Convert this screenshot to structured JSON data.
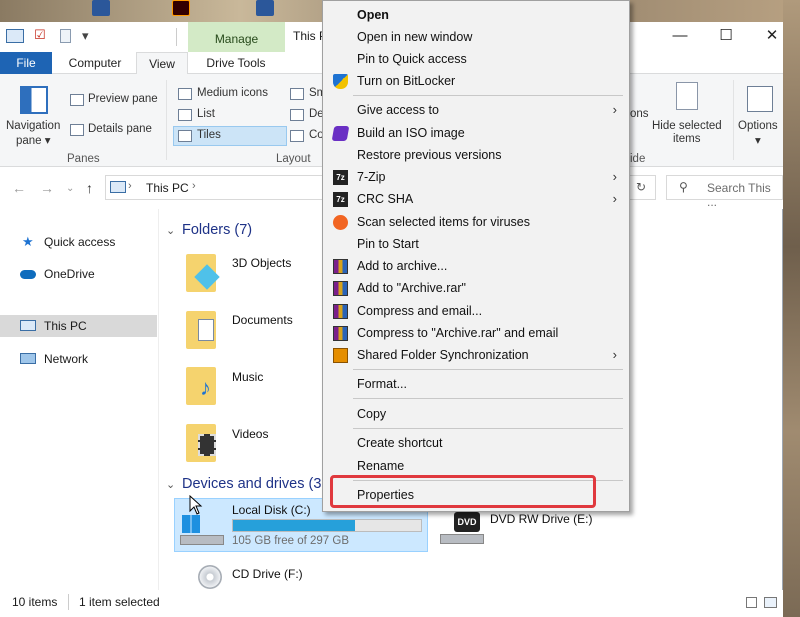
{
  "window": {
    "contextual_tab": "Manage",
    "title": "This PC",
    "minimize": "—",
    "maximize": "☐",
    "close": "✕"
  },
  "tabs": {
    "file": "File",
    "computer": "Computer",
    "view": "View",
    "drive_tools": "Drive Tools"
  },
  "ribbon": {
    "navigation_pane": "Navigation",
    "navigation_pane_2": "pane ▾",
    "preview_pane": "Preview pane",
    "details_pane": "Details pane",
    "panes_group": "Panes",
    "medium_icons": "Medium icons",
    "list": "List",
    "tiles": "Tiles",
    "small_partial": "Sm",
    "details_partial": "De",
    "content_partial": "Co",
    "layout_group": "Layout",
    "ons_partial": "ons",
    "hide_partial": "ide",
    "hide_selected": "Hide selected",
    "hide_selected_2": "items",
    "options": "Options",
    "options_caret": "▾"
  },
  "address": {
    "path": "This PC",
    "search_placeholder": "Search This ..."
  },
  "nav_pane": {
    "items": [
      "Quick access",
      "OneDrive",
      "This PC",
      "Network"
    ]
  },
  "content": {
    "folders_header": "Folders (7)",
    "folders": [
      "3D Objects",
      "Documents",
      "Music",
      "Videos"
    ],
    "devices_header": "Devices and drives (3",
    "drives": [
      {
        "name": "Local Disk (C:)",
        "free": "105 GB free of 297 GB",
        "used_fraction": 0.647
      },
      {
        "name": "DVD RW Drive (E:)"
      },
      {
        "name": "CD Drive (F:)"
      }
    ]
  },
  "status": {
    "count": "10 items",
    "selected": "1 item selected"
  },
  "context_menu": {
    "open": "Open",
    "open_new_window": "Open in new window",
    "pin_quick_access": "Pin to Quick access",
    "bitlocker": "Turn on BitLocker",
    "give_access": "Give access to",
    "build_iso": "Build an ISO image",
    "restore_versions": "Restore previous versions",
    "seven_zip": "7-Zip",
    "crc_sha": "CRC SHA",
    "scan_viruses": "Scan selected items for viruses",
    "pin_start": "Pin to Start",
    "add_archive": "Add to archive...",
    "add_archive_rar": "Add to \"Archive.rar\"",
    "compress_email": "Compress and email...",
    "compress_rar_email": "Compress to \"Archive.rar\" and email",
    "shared_sync": "Shared Folder Synchronization",
    "format": "Format...",
    "copy": "Copy",
    "create_shortcut": "Create shortcut",
    "rename": "Rename",
    "properties": "Properties",
    "submenu_glyph": "›"
  },
  "colors": {
    "accent": "#1e64b4",
    "highlight_border": "#e0393e",
    "selection": "#cce8ff",
    "manage_tab": "#d3eac6"
  }
}
